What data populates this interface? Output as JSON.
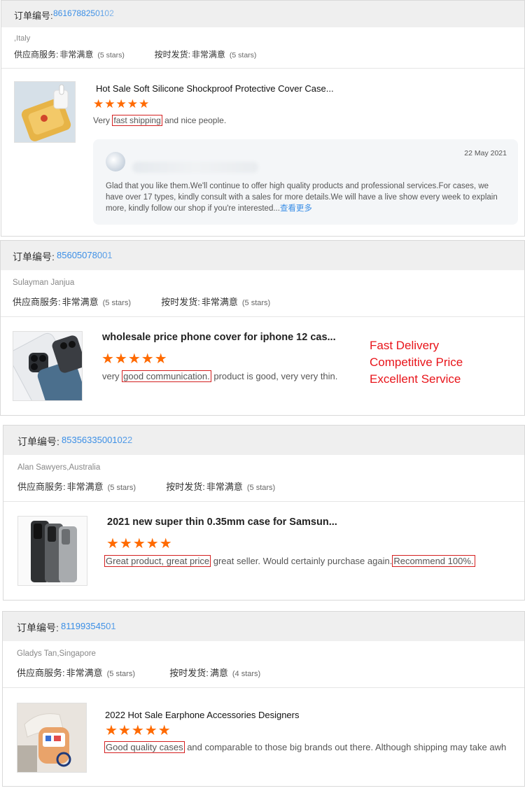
{
  "order_label": "订单编号:",
  "stars": "★★★★★",
  "supplier_service_label": "供应商服务:",
  "on_time_label": "按时发货:",
  "reviews": [
    {
      "order_number": "8616788250102",
      "buyer": ",Italy",
      "supplier_rating": "非常满意",
      "supplier_stars": "(5 stars)",
      "shipping_rating": "非常满意",
      "shipping_stars": "(5 stars)",
      "product_title": "Hot Sale Soft Silicone Shockproof Protective Cover Case...",
      "review_before": "Very ",
      "review_hl1": "fast shipping",
      "review_after": " and nice people.",
      "reply": {
        "date": "22 May 2021",
        "text": "Glad that you like them.We'll continue to offer high quality products and professional services.For cases, we have over 17 types, kindly consult with a sales for more details.We will have a live show every week to explain more, kindly follow our shop if you're interested...",
        "more": "查看更多"
      }
    },
    {
      "order_number": "85605078001",
      "buyer": "Sulayman Janjua",
      "supplier_rating": "非常满意",
      "supplier_stars": "(5 stars)",
      "shipping_rating": "非常满意",
      "shipping_stars": "(5 stars)",
      "product_title": "wholesale price phone cover for iphone 12 cas...",
      "review_before": "very ",
      "review_hl1": "good communication.",
      "review_after": " product is good, very very thin."
    },
    {
      "order_number": "85356335001022",
      "buyer": "Alan Sawyers,Australia",
      "supplier_rating": "非常满意",
      "supplier_stars": "(5 stars)",
      "shipping_rating": "非常满意",
      "shipping_stars": "(5 stars)",
      "product_title": "2021 new super thin 0.35mm case for Samsun...",
      "review_hl1": "Great product, great price",
      "review_middle": " great seller. Would certainly purchase again.",
      "review_hl2": "Recommend 100%."
    },
    {
      "order_number": "81199354501",
      "buyer": "Gladys Tan,Singapore",
      "supplier_rating": "非常满意",
      "supplier_stars": "(5 stars)",
      "shipping_rating": "满意",
      "shipping_stars": "(4 stars)",
      "product_title": "2022 Hot Sale Earphone Accessories Designers",
      "review_hl1": "Good quality cases",
      "review_after": " and comparable to those big brands out there. Although shipping may take awh"
    }
  ],
  "promo": [
    "Fast Delivery",
    "Competitive Price",
    "Excellent Service"
  ],
  "colors": {
    "accent_blue": "#3a8ee6",
    "star_orange": "#ff6a00",
    "highlight_red": "#d42020",
    "promo_red": "#e8141a"
  }
}
